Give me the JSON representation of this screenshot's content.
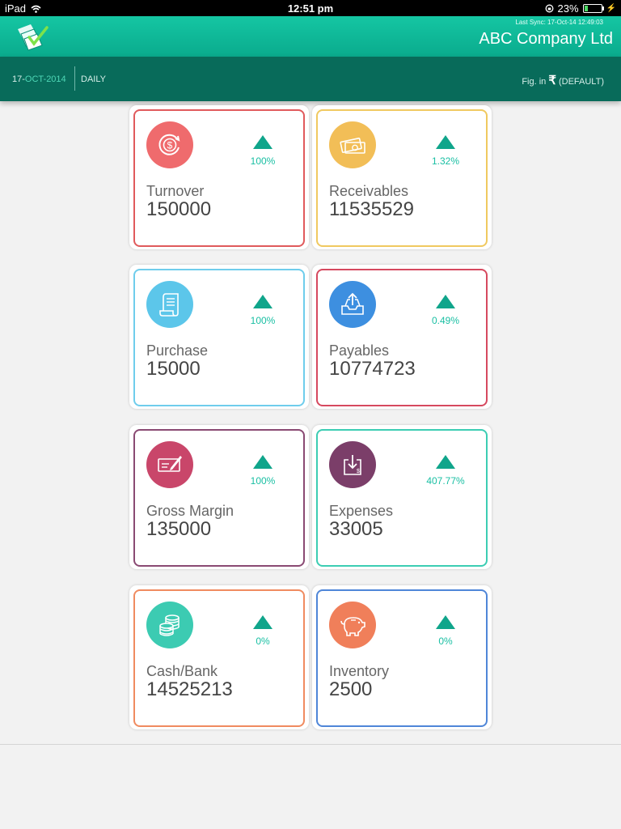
{
  "status_bar": {
    "device": "iPad",
    "time": "12:51 pm",
    "battery": "23%",
    "battery_level": 0.23
  },
  "header": {
    "last_sync": "Last Sync: 17-Oct-14 12:49:03",
    "company": "ABC Company Ltd"
  },
  "subheader": {
    "date_day": "17-",
    "date_month": "OCT",
    "date_year": "-2014",
    "period": "DAILY",
    "fig_label": "Fig. in",
    "currency_symbol": "₹",
    "fig_unit": "(DEFAULT)"
  },
  "cards": [
    {
      "label": "Turnover",
      "value": "150000",
      "pct": "100%",
      "icon": "dollar-refresh-icon",
      "color": "#ef6b6d",
      "border": "#e05a5c"
    },
    {
      "label": "Receivables",
      "value": "11535529",
      "pct": "1.32%",
      "icon": "cash-money-icon",
      "color": "#f2be57",
      "border": "#f0c960"
    },
    {
      "label": "Purchase",
      "value": "15000",
      "pct": "100%",
      "icon": "receipt-icon",
      "color": "#5cc6ea",
      "border": "#6fcdec"
    },
    {
      "label": "Payables",
      "value": "10774723",
      "pct": "0.49%",
      "icon": "outbox-upload-icon",
      "color": "#3d8fe0",
      "border": "#d6495f"
    },
    {
      "label": "Gross Margin",
      "value": "135000",
      "pct": "100%",
      "icon": "cheque-icon",
      "color": "#c9466a",
      "border": "#8a4a73"
    },
    {
      "label": "Expenses",
      "value": "33005",
      "pct": "407.77%",
      "icon": "download-tray-icon",
      "color": "#7b3e69",
      "border": "#3ccdb3"
    },
    {
      "label": "Cash/Bank",
      "value": "14525213",
      "pct": "0%",
      "icon": "coins-stack-icon",
      "color": "#3ccbb2",
      "border": "#f08b60"
    },
    {
      "label": "Inventory",
      "value": "2500",
      "pct": "0%",
      "icon": "piggy-bank-icon",
      "color": "#f07f5a",
      "border": "#4f86d8"
    }
  ]
}
